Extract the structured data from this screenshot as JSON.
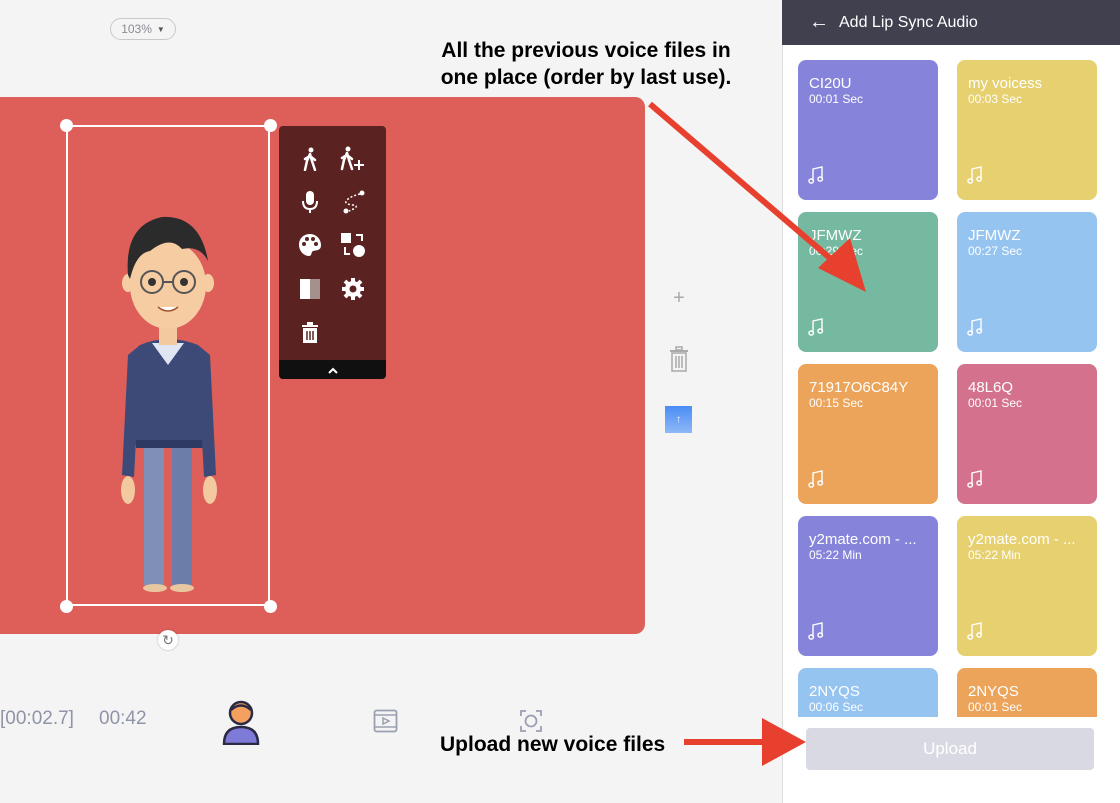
{
  "canvas": {
    "zoom_label": "103%",
    "stage_color": "#de5f5a"
  },
  "toolbar": {
    "icons": [
      "walk-icon",
      "walk-add-icon",
      "microphone-icon",
      "motion-path-icon",
      "palette-icon",
      "swap-icon",
      "opacity-icon",
      "gear-icon",
      "trash-icon"
    ],
    "collapse_icon": "chevron-up-icon"
  },
  "timeline": {
    "current_time": "[00:02.7]",
    "total_time": "00:42"
  },
  "annotations": {
    "top": "All the previous voice files in one place (order by last use).",
    "bottom": "Upload new voice files"
  },
  "panel": {
    "back_icon": "arrow-left-icon",
    "title": "Add Lip Sync Audio",
    "cards": [
      {
        "name": "CI20U",
        "duration": "00:01 Sec",
        "color": "#8684da"
      },
      {
        "name": "my voicess",
        "duration": "00:03 Sec",
        "color": "#e6d06f"
      },
      {
        "name": "JFMWZ",
        "duration": "00:29 Sec",
        "color": "#74b9a0"
      },
      {
        "name": "JFMWZ",
        "duration": "00:27 Sec",
        "color": "#96c4f1"
      },
      {
        "name": "71917O6C84Y",
        "duration": "00:15 Sec",
        "color": "#eba45a"
      },
      {
        "name": "48L6Q",
        "duration": "00:01 Sec",
        "color": "#d4728e"
      },
      {
        "name": "y2mate.com - ...",
        "duration": "05:22 Min",
        "color": "#8684da"
      },
      {
        "name": "y2mate.com - ...",
        "duration": "05:22 Min",
        "color": "#e6d06f"
      },
      {
        "name": "2NYQS",
        "duration": "00:06 Sec",
        "color": "#96c4f1"
      },
      {
        "name": "2NYQS",
        "duration": "00:01 Sec",
        "color": "#eba45a"
      }
    ],
    "upload_label": "Upload"
  },
  "colors": {
    "header_bg": "#40404f",
    "arrow": "#e8402f",
    "upload_bg": "#d9d9e3"
  }
}
